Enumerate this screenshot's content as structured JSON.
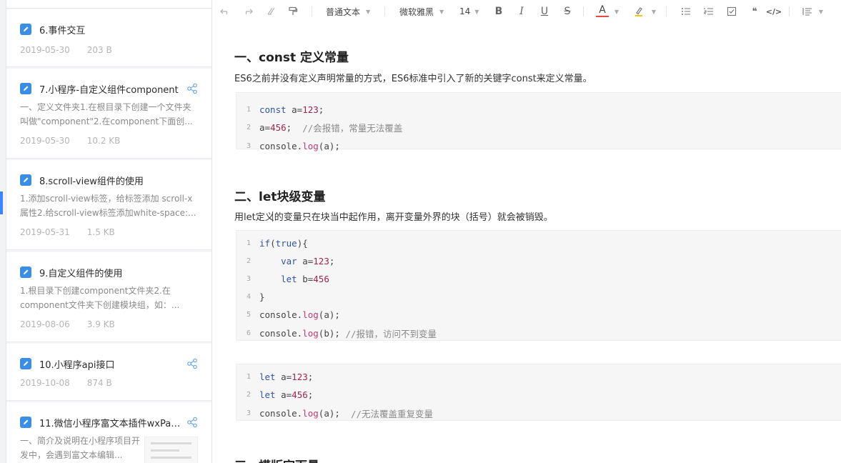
{
  "notes": [
    {
      "title": "6.事件交互",
      "date": "2019-05-30",
      "size": "203 B",
      "snippet": "",
      "shared": false
    },
    {
      "title": "7.小程序-自定义组件component",
      "date": "2019-05-30",
      "size": "10.2 KB",
      "snippet": "一、定义文件夹1.在根目录下创建一个文件夹叫做\"component\"2.在component下面创...",
      "shared": true
    },
    {
      "title": "8.scroll-view组件的使用",
      "date": "2019-05-31",
      "size": "1.5 KB",
      "snippet": "1.添加scroll-view标签，给标签添加 scroll-x属性2.给scroll-view标签添加white-space:...",
      "shared": false
    },
    {
      "title": "9.自定义组件的使用",
      "date": "2019-08-06",
      "size": "3.9 KB",
      "snippet": "1.根目录下创建component文件夹2.在component文件夹下创建模块组，如：...",
      "shared": false
    },
    {
      "title": "10.小程序api接口",
      "date": "2019-10-08",
      "size": "874 B",
      "snippet": "",
      "shared": true
    },
    {
      "title": "11.微信小程序富文本插件wxPar...",
      "date": "",
      "size": "",
      "snippet": "一、简介及说明在小程序项目开发中，会遇到富文本编辑...",
      "shared": true
    }
  ],
  "toolbar": {
    "paragraph_style": "普通文本",
    "font_family": "微软雅黑",
    "font_size": "14",
    "icons": [
      "undo-icon",
      "redo-icon",
      "clear-format-icon",
      "format-painter-icon",
      "bold-icon",
      "italic-icon",
      "underline-icon",
      "strikethrough-icon",
      "font-color-icon",
      "highlight-icon",
      "bullet-list-icon",
      "numbered-list-icon",
      "checklist-icon",
      "quote-icon",
      "code-icon",
      "align-icon"
    ],
    "bold": "B",
    "italic": "I",
    "underline": "U",
    "strike": "S",
    "font_color": "A",
    "quote": "❝",
    "code": "</>"
  },
  "document": {
    "sections": [
      {
        "heading": "一、const 定义常量",
        "desc": "ES6之前并没有定义声明常量的方式，ES6标准中引入了新的关键字const来定义常量。"
      },
      {
        "heading": "二、let块级变量",
        "desc": "用let定义的变量只在块当中起作用，离开变量外界的块（括号）就会被销毁。"
      },
      {
        "heading": "三、模版字面量",
        "desc": ""
      }
    ],
    "code_blocks": [
      {
        "lines": [
          {
            "n": "1",
            "tokens": [
              [
                "kw",
                "const "
              ],
              [
                "plain",
                "a="
              ],
              [
                "num",
                "123"
              ],
              [
                "plain",
                ";"
              ]
            ]
          },
          {
            "n": "2",
            "tokens": [
              [
                "plain",
                "a="
              ],
              [
                "num",
                "456"
              ],
              [
                "plain",
                ";  "
              ],
              [
                "cm",
                "//会报错，常量无法覆盖"
              ]
            ]
          },
          {
            "n": "3",
            "tokens": [
              [
                "plain",
                "console."
              ],
              [
                "fn",
                "log"
              ],
              [
                "plain",
                "(a);"
              ]
            ]
          }
        ]
      },
      {
        "lines": [
          {
            "n": "1",
            "tokens": [
              [
                "kw",
                "if"
              ],
              [
                "plain",
                "("
              ],
              [
                "kw",
                "true"
              ],
              [
                "plain",
                ")"
              ],
              [
                "plain",
                "{"
              ]
            ]
          },
          {
            "n": "2",
            "tokens": [
              [
                "plain",
                "    "
              ],
              [
                "kw",
                "var "
              ],
              [
                "plain",
                "a="
              ],
              [
                "num",
                "123"
              ],
              [
                "plain",
                ";"
              ]
            ]
          },
          {
            "n": "3",
            "tokens": [
              [
                "plain",
                "    "
              ],
              [
                "kw",
                "let "
              ],
              [
                "plain",
                "b="
              ],
              [
                "num",
                "456"
              ]
            ]
          },
          {
            "n": "4",
            "tokens": [
              [
                "plain",
                "}"
              ]
            ]
          },
          {
            "n": "5",
            "tokens": [
              [
                "plain",
                "console."
              ],
              [
                "fn",
                "log"
              ],
              [
                "plain",
                "(a);"
              ]
            ]
          },
          {
            "n": "6",
            "tokens": [
              [
                "plain",
                "console."
              ],
              [
                "fn",
                "log"
              ],
              [
                "plain",
                "(b); "
              ],
              [
                "cm",
                "//报错，访问不到变量"
              ]
            ]
          }
        ]
      },
      {
        "lines": [
          {
            "n": "1",
            "tokens": [
              [
                "kw",
                "let "
              ],
              [
                "plain",
                "a="
              ],
              [
                "num",
                "123"
              ],
              [
                "plain",
                ";"
              ]
            ]
          },
          {
            "n": "2",
            "tokens": [
              [
                "kw",
                "let "
              ],
              [
                "plain",
                "a="
              ],
              [
                "num",
                "456"
              ],
              [
                "plain",
                ";"
              ]
            ]
          },
          {
            "n": "3",
            "tokens": [
              [
                "plain",
                "console."
              ],
              [
                "fn",
                "log"
              ],
              [
                "plain",
                "(a);  "
              ],
              [
                "cm",
                "//无法覆盖重复变量"
              ]
            ]
          }
        ]
      }
    ]
  },
  "colors": {
    "accent": "#3a86ff",
    "note_icon": "#3a8ee6",
    "keyword": "#2f55a8",
    "number": "#a0244f",
    "function": "#c23b74",
    "comment": "#8a8a8a"
  }
}
